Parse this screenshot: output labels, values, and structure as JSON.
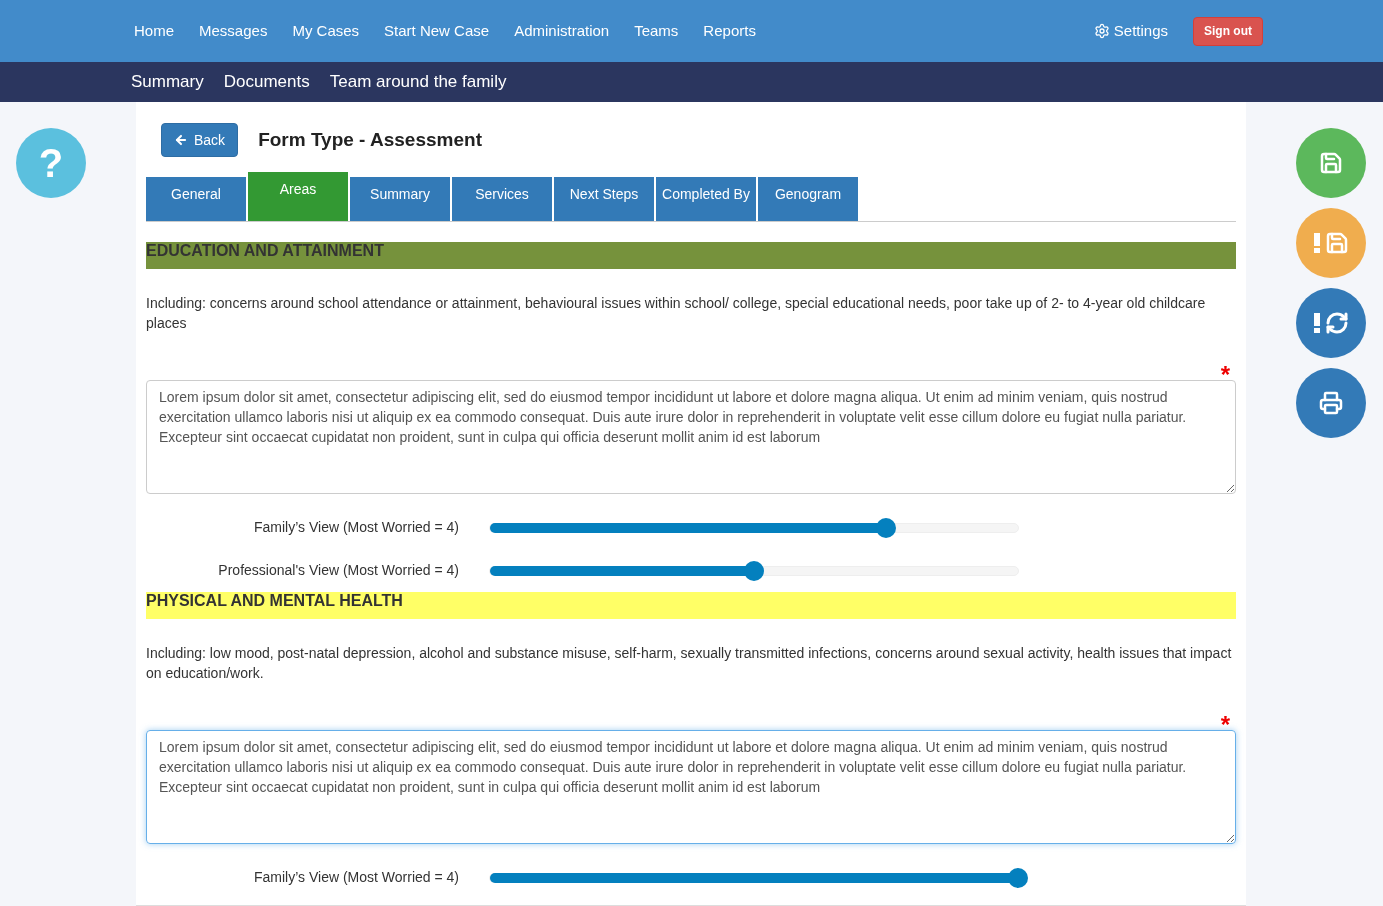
{
  "nav": {
    "items": [
      "Home",
      "Messages",
      "My Cases",
      "Start New Case",
      "Administration",
      "Teams",
      "Reports"
    ],
    "settings": "Settings",
    "sign_out": "Sign out"
  },
  "subnav": {
    "items": [
      "Summary",
      "Documents",
      "Team around the family"
    ]
  },
  "side_left": {
    "help": "?"
  },
  "side_right": {
    "buttons": [
      {
        "kind": "save",
        "color": "#5cb85c"
      },
      {
        "kind": "save-alert",
        "color": "#f0ad4e"
      },
      {
        "kind": "refresh-alert",
        "color": "#337ab7"
      },
      {
        "kind": "print",
        "color": "#337ab7"
      }
    ]
  },
  "back": "Back",
  "title": "Form Type - Assessment",
  "tabs": [
    {
      "label": "General",
      "selected": false
    },
    {
      "label": "Areas",
      "selected": true
    },
    {
      "label": "Summary",
      "selected": false
    },
    {
      "label": "Services",
      "selected": false
    },
    {
      "label": "Next Steps",
      "selected": false
    },
    {
      "label": "Completed By",
      "selected": false
    },
    {
      "label": "Genogram",
      "selected": false
    }
  ],
  "sections": [
    {
      "heading": "EDUCATION AND ATTAINMENT",
      "color": "#76923c",
      "description": "Including: concerns around school attendance or attainment, behavioural issues within school/ college, special educational needs, poor take up of 2- to 4-year old childcare places",
      "required": "*",
      "answer": "Lorem ipsum dolor sit amet, consectetur adipiscing elit, sed do eiusmod tempor incididunt ut labore et dolore magna aliqua. Ut enim ad minim veniam, quis nostrud exercitation ullamco laboris nisi ut aliquip ex ea commodo consequat. Duis aute irure dolor in reprehenderit in voluptate velit esse cillum dolore eu fugiat nulla pariatur. Excepteur sint occaecat cupidatat non proident, sunt in culpa qui officia deserunt mollit anim id est laborum",
      "focused": false,
      "sliders": [
        {
          "label": "Family’s View (Most Worried = 4)",
          "level": 0.75
        },
        {
          "label": "Professional's View (Most Worried = 4)",
          "level": 0.5
        }
      ]
    },
    {
      "heading": "PHYSICAL AND MENTAL HEALTH",
      "color": "#ffff66",
      "description": "Including: low mood, post-natal depression, alcohol and substance misuse, self-harm, sexually transmitted infections, concerns around sexual activity, health issues that impact on education/work.",
      "required": "*",
      "answer": "Lorem ipsum dolor sit amet, consectetur adipiscing elit, sed do eiusmod tempor incididunt ut labore et dolore magna aliqua. Ut enim ad minim veniam, quis nostrud exercitation ullamco laboris nisi ut aliquip ex ea commodo consequat. Duis aute irure dolor in reprehenderit in voluptate velit esse cillum dolore eu fugiat nulla pariatur. Excepteur sint occaecat cupidatat non proident, sunt in culpa qui officia deserunt mollit anim id est laborum",
      "focused": true,
      "sliders": [
        {
          "label": "Family’s View (Most Worried = 4)",
          "level": 1.0
        }
      ]
    }
  ]
}
